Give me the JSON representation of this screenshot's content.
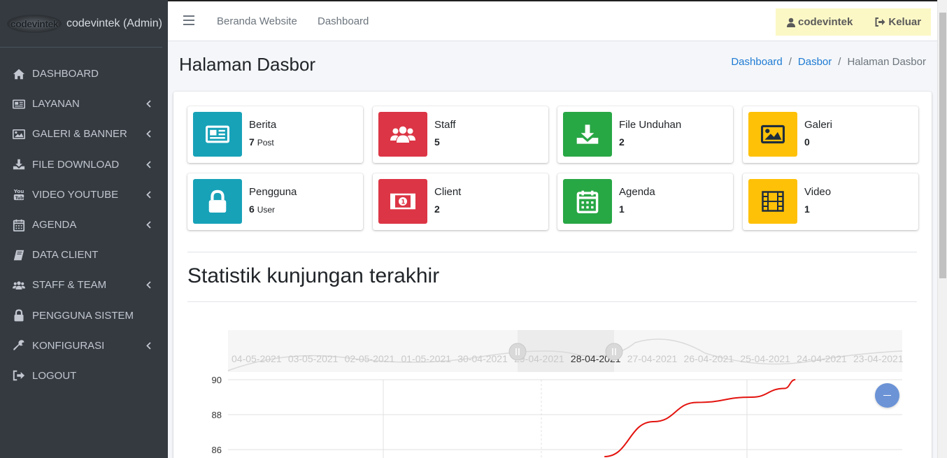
{
  "brand": {
    "logo_text": "codevintek",
    "name": "codevintek (Admin)"
  },
  "sidebar": {
    "items": [
      {
        "label": "DASHBOARD",
        "icon": "home-icon",
        "has_arrow": false
      },
      {
        "label": "LAYANAN",
        "icon": "newspaper-icon",
        "has_arrow": true
      },
      {
        "label": "GALERI & BANNER",
        "icon": "image-icon",
        "has_arrow": true
      },
      {
        "label": "FILE DOWNLOAD",
        "icon": "download-icon",
        "has_arrow": true
      },
      {
        "label": "VIDEO YOUTUBE",
        "icon": "youtube-icon",
        "has_arrow": true
      },
      {
        "label": "AGENDA",
        "icon": "calendar-icon",
        "has_arrow": true
      },
      {
        "label": "DATA CLIENT",
        "icon": "book-icon",
        "has_arrow": false
      },
      {
        "label": "STAFF & TEAM",
        "icon": "users-icon",
        "has_arrow": true
      },
      {
        "label": "PENGGUNA SISTEM",
        "icon": "lock-icon",
        "has_arrow": false
      },
      {
        "label": "KONFIGURASI",
        "icon": "wrench-icon",
        "has_arrow": true
      },
      {
        "label": "LOGOUT",
        "icon": "sign-out-icon",
        "has_arrow": false
      }
    ]
  },
  "topbar": {
    "links": [
      "Beranda Website",
      "Dashboard"
    ],
    "user_label": "codevintek",
    "logout_label": "Keluar"
  },
  "header": {
    "title": "Halaman Dasbor",
    "breadcrumb": [
      "Dashboard",
      "Dasbor",
      "Halaman Dasbor"
    ]
  },
  "info_boxes": [
    {
      "title": "Berita",
      "value": "7",
      "unit": "Post",
      "color": "#17a2b8",
      "icon": "newspaper-icon"
    },
    {
      "title": "Staff",
      "value": "5",
      "unit": "",
      "color": "#dc3545",
      "icon": "users-icon"
    },
    {
      "title": "File Unduhan",
      "value": "2",
      "unit": "",
      "color": "#28a745",
      "icon": "download-icon"
    },
    {
      "title": "Galeri",
      "value": "0",
      "unit": "",
      "color": "#ffc107",
      "icon": "image-icon"
    },
    {
      "title": "Pengguna",
      "value": "6",
      "unit": "User",
      "color": "#17a2b8",
      "icon": "lock-icon"
    },
    {
      "title": "Client",
      "value": "2",
      "unit": "",
      "color": "#dc3545",
      "icon": "money-icon"
    },
    {
      "title": "Agenda",
      "value": "1",
      "unit": "",
      "color": "#28a745",
      "icon": "calendar-icon"
    },
    {
      "title": "Video",
      "value": "1",
      "unit": "",
      "color": "#ffc107",
      "icon": "film-icon"
    }
  ],
  "stats_title": "Statistik kunjungan terakhir",
  "chart_data": {
    "type": "line",
    "navigator_labels": [
      "04-05-2021",
      "03-05-2021",
      "02-05-2021",
      "01-05-2021",
      "30-04-2021",
      "29-04-2021",
      "28-04-2021",
      "27-04-2021",
      "26-04-2021",
      "25-04-2021",
      "24-04-2021",
      "23-04-2021"
    ],
    "y_ticks": [
      90,
      88,
      86
    ],
    "visible_ylim": [
      85.6,
      90
    ],
    "series": [
      {
        "color": "#e3140f",
        "points": [
          [
            3.45,
            85.6
          ],
          [
            3.9,
            87.6
          ],
          [
            4.3,
            88.7
          ],
          [
            4.8,
            89.0
          ],
          [
            5.1,
            89.5
          ],
          [
            5.2,
            90.0
          ]
        ]
      }
    ]
  }
}
